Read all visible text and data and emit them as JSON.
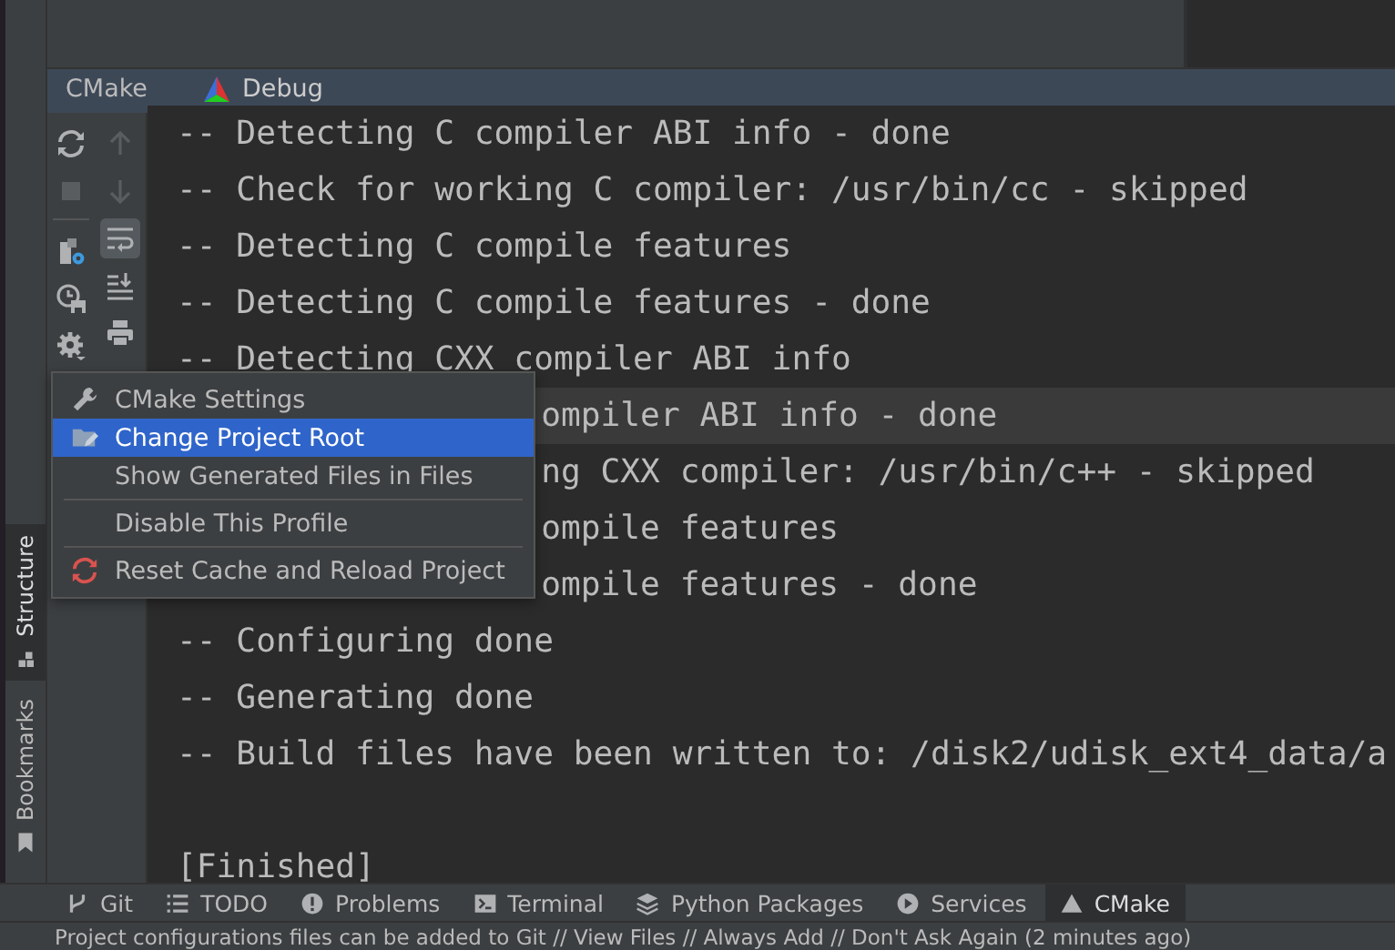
{
  "tool_window": {
    "tabs": [
      {
        "label": "CMake",
        "selected": false
      },
      {
        "label": "Debug",
        "selected": true
      }
    ]
  },
  "toolbar_left": [
    {
      "kind": "rerun",
      "disabled": false
    },
    {
      "kind": "stop",
      "disabled": true
    },
    {
      "kind": "separator"
    },
    {
      "kind": "settings-file",
      "disabled": false
    },
    {
      "kind": "clock-save",
      "disabled": false
    },
    {
      "kind": "gear",
      "disabled": false
    }
  ],
  "toolbar_right": [
    {
      "kind": "up",
      "disabled": true,
      "on": false
    },
    {
      "kind": "down",
      "disabled": true,
      "on": false
    },
    {
      "kind": "wrap",
      "disabled": false,
      "on": true
    },
    {
      "kind": "scroll-end",
      "disabled": false,
      "on": false
    },
    {
      "kind": "print",
      "disabled": false,
      "on": false
    }
  ],
  "console": [
    {
      "kind": "full",
      "text": "-- Detecting C compiler ABI info - done",
      "current": false
    },
    {
      "kind": "full",
      "text": "-- Check for working C compiler: /usr/bin/cc - skipped",
      "current": false
    },
    {
      "kind": "full",
      "text": "-- Detecting C compile features",
      "current": false
    },
    {
      "kind": "full",
      "text": "-- Detecting C compile features - done",
      "current": false
    },
    {
      "kind": "full",
      "text": "-- Detecting CXX compiler ABI info",
      "current": false
    },
    {
      "kind": "covered",
      "text": "ompiler ABI info - done",
      "current": true
    },
    {
      "kind": "covered",
      "text": "ng CXX compiler: /usr/bin/c++ - skipped",
      "current": false
    },
    {
      "kind": "covered",
      "text": "ompile features",
      "current": false
    },
    {
      "kind": "covered",
      "text": "ompile features - done",
      "current": false
    },
    {
      "kind": "full",
      "text": "-- Configuring done",
      "current": false
    },
    {
      "kind": "full",
      "text": "-- Generating done",
      "current": false
    },
    {
      "kind": "full",
      "text": "-- Build files have been written to: /disk2/udisk_ext4_data/a",
      "current": false
    },
    {
      "kind": "blank",
      "current": false
    },
    {
      "kind": "full",
      "text": "[Finished]",
      "current": false
    }
  ],
  "menu": [
    {
      "kind": "item",
      "label": "CMake Settings",
      "selected": false
    },
    {
      "kind": "item",
      "label": "Change Project Root",
      "selected": true
    },
    {
      "kind": "item",
      "label": "Show Generated Files in Files",
      "selected": false
    },
    {
      "kind": "separator"
    },
    {
      "kind": "item",
      "label": "Disable This Profile",
      "selected": false
    },
    {
      "kind": "separator"
    },
    {
      "kind": "item",
      "label": "Reset Cache and Reload Project",
      "selected": false
    }
  ],
  "side_tabs": [
    {
      "label": "Structure",
      "selected": true
    },
    {
      "label": "Bookmarks",
      "selected": false
    }
  ],
  "bottom_tools": [
    {
      "label": "Git",
      "selected": false
    },
    {
      "label": "TODO",
      "selected": false
    },
    {
      "label": "Problems",
      "selected": false
    },
    {
      "label": "Terminal",
      "selected": false
    },
    {
      "label": "Python Packages",
      "selected": false
    },
    {
      "label": "Services",
      "selected": false
    },
    {
      "label": "CMake",
      "selected": true
    }
  ],
  "status_bar": {
    "text": "Project configurations files can be added to Git // View Files // Always Add // Don't Ask Again (2 minutes ago)"
  }
}
